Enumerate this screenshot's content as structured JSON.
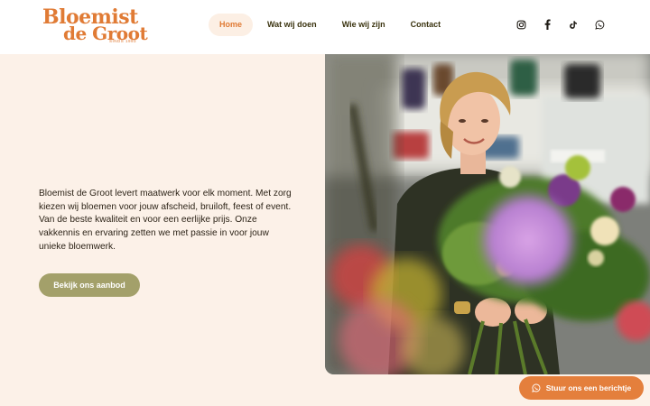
{
  "logo": {
    "line1": "Bloemist",
    "line2": "de Groot",
    "since": "SINDS 1993"
  },
  "nav": {
    "items": [
      {
        "label": "Home",
        "active": true
      },
      {
        "label": "Wat wij doen",
        "active": false
      },
      {
        "label": "Wie wij zijn",
        "active": false
      },
      {
        "label": "Contact",
        "active": false
      }
    ]
  },
  "social": [
    "instagram-icon",
    "facebook-icon",
    "tiktok-icon",
    "whatsapp-icon"
  ],
  "hero": {
    "text": "Bloemist de Groot levert maatwerk voor elk moment. Met zorg kiezen wij bloemen voor jouw afscheid, bruiloft, feest of event. Van de beste kwaliteit en voor een eerlijke prijs. Onze vakkennis en ervaring zetten we met passie in voor jouw unieke bloemwerk.",
    "cta_label": "Bekijk ons aanbod"
  },
  "chat": {
    "label": "Stuur ons een berichtje"
  },
  "colors": {
    "accent": "#e07b35",
    "olive": "#a3a06a",
    "cream": "#fcf1e8",
    "chat": "#e47f3c"
  }
}
